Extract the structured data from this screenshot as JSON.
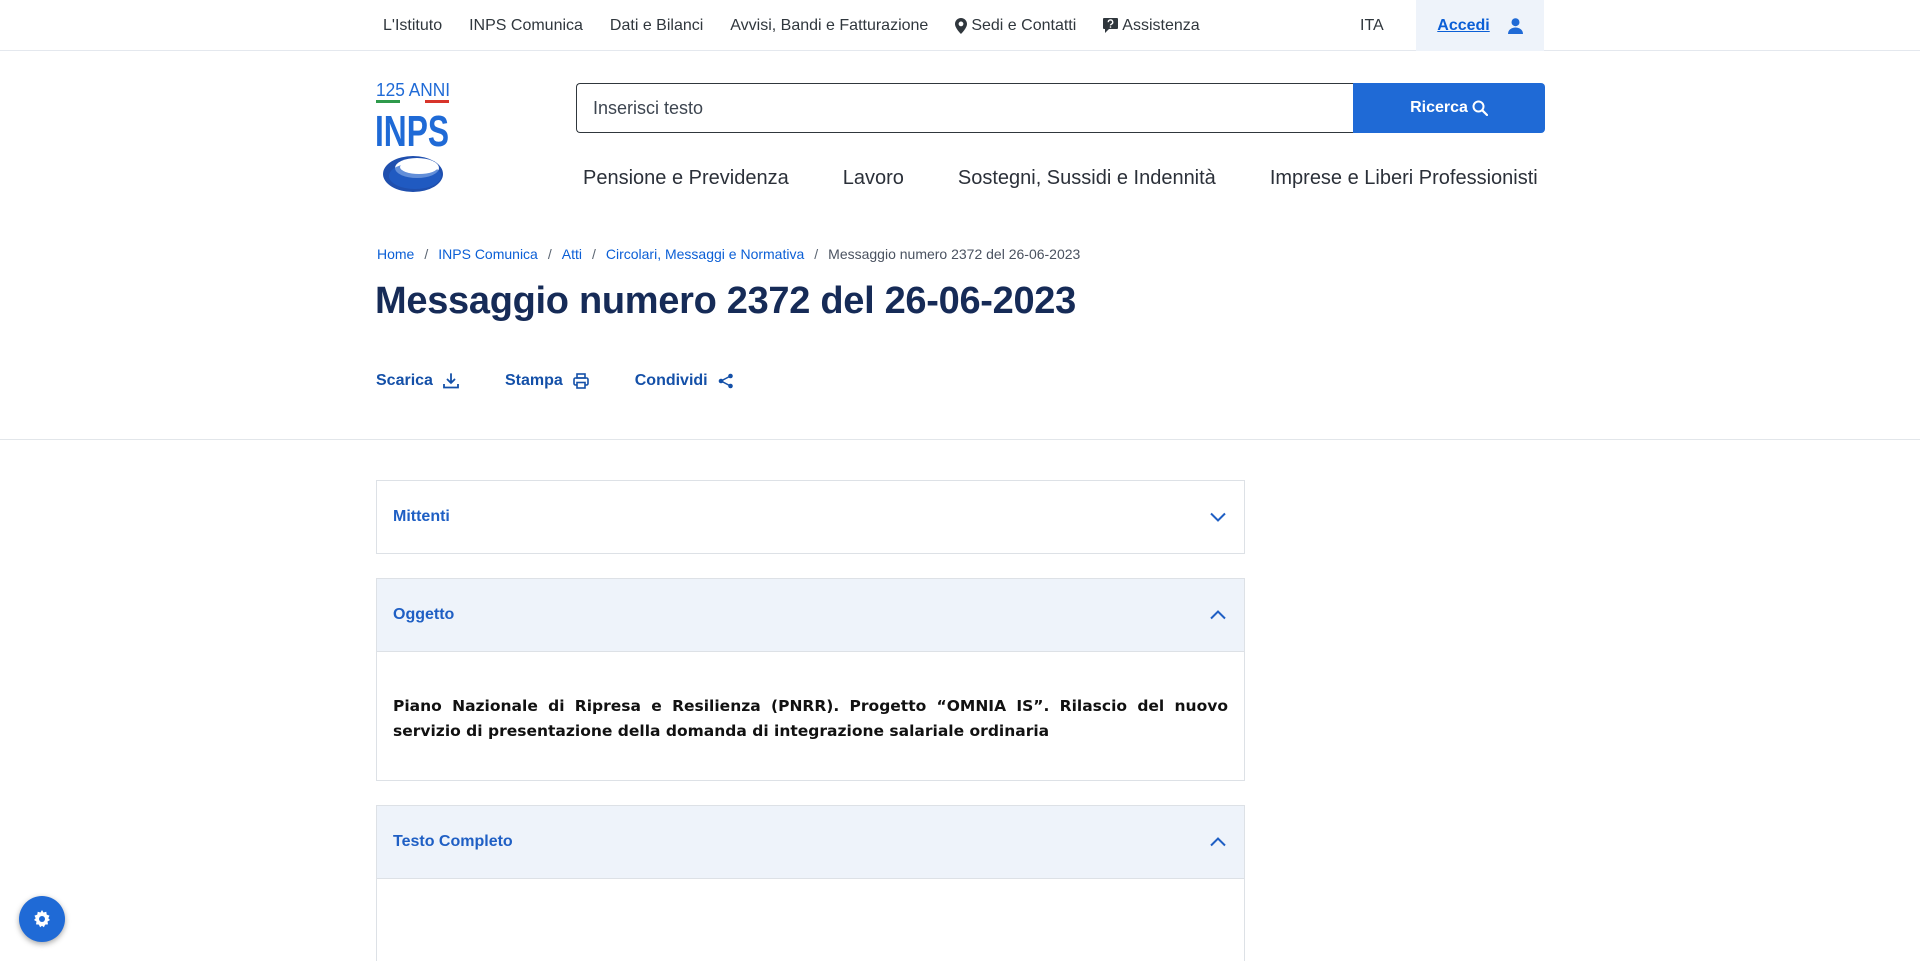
{
  "topnav": {
    "items": [
      "L'Istituto",
      "INPS Comunica",
      "Dati e Bilanci",
      "Avvisi, Bandi e Fatturazione",
      "Sedi e Contatti",
      "Assistenza"
    ],
    "lang": "ITA",
    "login": "Accedi"
  },
  "logo": {
    "anniversary": "125 ANNI",
    "brand": "INPS"
  },
  "search": {
    "placeholder": "Inserisci testo",
    "button": "Ricerca"
  },
  "mainnav": [
    "Pensione e Previdenza",
    "Lavoro",
    "Sostegni, Sussidi e Indennità",
    "Imprese e Liberi Professionisti"
  ],
  "breadcrumb": [
    "Home",
    "INPS Comunica",
    "Atti",
    "Circolari, Messaggi e Normativa",
    "Messaggio numero 2372 del 26-06-2023"
  ],
  "page_title": "Messaggio numero 2372 del 26-06-2023",
  "actions": {
    "download": "Scarica",
    "print": "Stampa",
    "share": "Condividi"
  },
  "accordions": [
    {
      "title": "Mittenti"
    },
    {
      "title": "Oggetto",
      "body": "Piano Nazionale di Ripresa e Resilienza (PNRR). Progetto “OMNIA IS”. Rilascio del nuovo servizio di presentazione della domanda di integrazione salariale ordinaria"
    },
    {
      "title": "Testo Completo"
    }
  ],
  "colors": {
    "primary": "#1f6ad6",
    "title": "#162b57",
    "link": "#0b5fd6",
    "panel": "#eef3fa"
  }
}
